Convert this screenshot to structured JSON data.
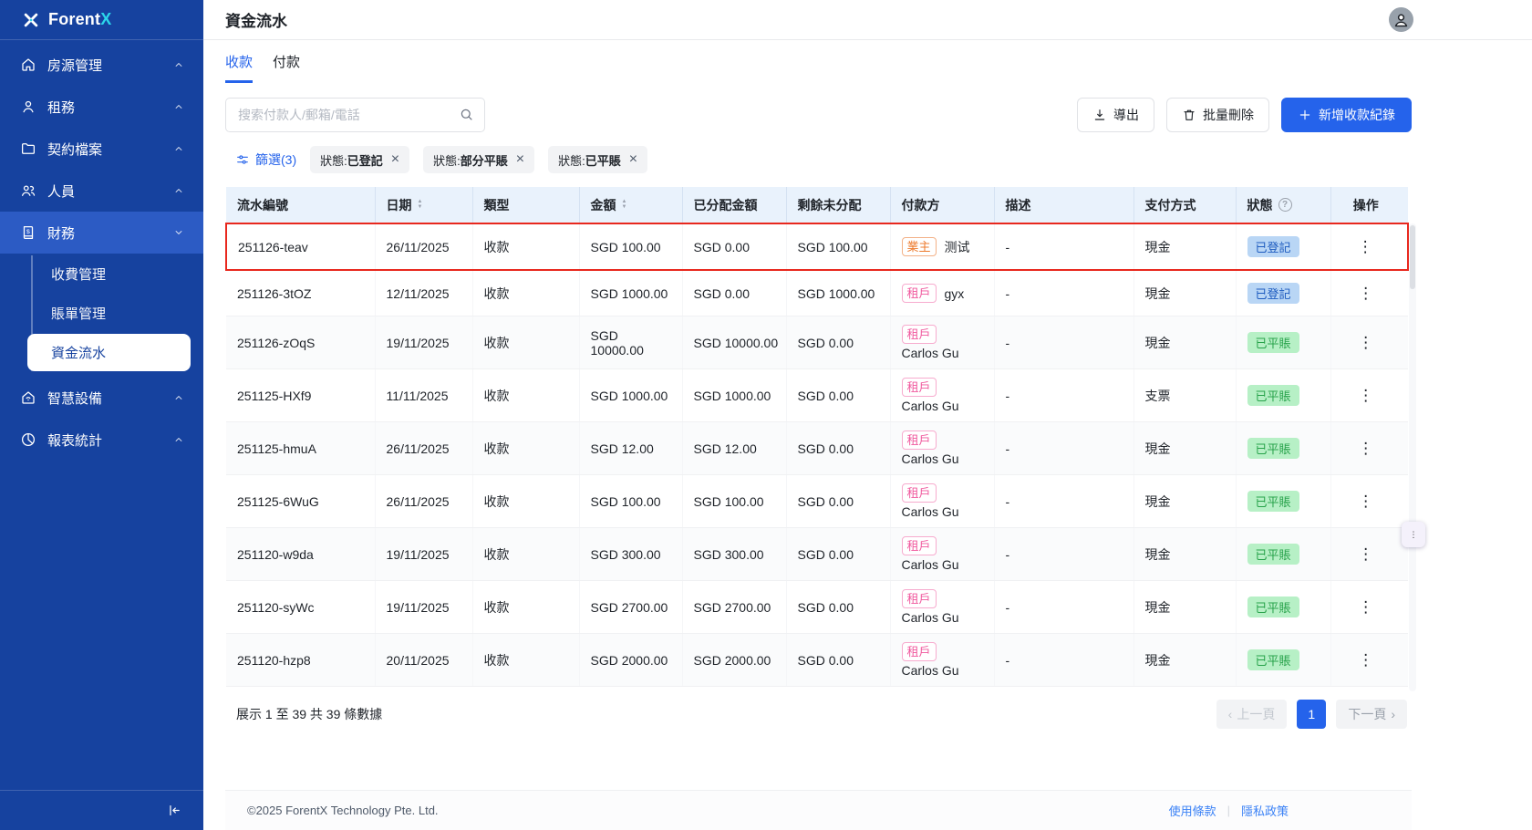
{
  "sidebar": {
    "logo": {
      "text": "Forent",
      "accent": "X"
    },
    "items": [
      {
        "name": "properties",
        "label": "房源管理",
        "icon": "home-icon",
        "expanded": false,
        "active": false
      },
      {
        "name": "leasing",
        "label": "租務",
        "icon": "user-icon",
        "expanded": false,
        "active": false
      },
      {
        "name": "contracts",
        "label": "契約檔案",
        "icon": "folder-icon",
        "expanded": false,
        "active": false
      },
      {
        "name": "people",
        "label": "人員",
        "icon": "users-icon",
        "expanded": false,
        "active": false
      },
      {
        "name": "finance",
        "label": "財務",
        "icon": "finance-icon",
        "expanded": true,
        "active": true,
        "children": [
          {
            "name": "fee-management",
            "label": "收費管理",
            "active": false
          },
          {
            "name": "bill-management",
            "label": "賬單管理",
            "active": false
          },
          {
            "name": "fund-flow",
            "label": "資金流水",
            "active": true
          }
        ]
      },
      {
        "name": "smart-devices",
        "label": "智慧設備",
        "icon": "smart-device-icon",
        "expanded": false,
        "active": false
      },
      {
        "name": "reports",
        "label": "報表統計",
        "icon": "report-icon",
        "expanded": false,
        "active": false
      }
    ]
  },
  "header": {
    "title": "資金流水"
  },
  "tabs": [
    {
      "name": "receipts",
      "label": "收款",
      "active": true
    },
    {
      "name": "payments",
      "label": "付款",
      "active": false
    }
  ],
  "search": {
    "placeholder": "搜索付款人/郵箱/電話"
  },
  "toolbar": {
    "export_label": "導出",
    "bulk_delete_label": "批量刪除",
    "add_label": "新增收款紀錄"
  },
  "filter": {
    "label": "篩選(3)",
    "chips": [
      {
        "field": "狀態",
        "value": "已登記"
      },
      {
        "field": "狀態",
        "value": "部分平賬"
      },
      {
        "field": "狀態",
        "value": "已平賬"
      }
    ]
  },
  "table": {
    "columns": [
      {
        "label": "流水編號"
      },
      {
        "label": "日期",
        "sortable": true
      },
      {
        "label": "類型"
      },
      {
        "label": "金額",
        "sortable": true
      },
      {
        "label": "已分配金額"
      },
      {
        "label": "剩餘未分配"
      },
      {
        "label": "付款方"
      },
      {
        "label": "描述"
      },
      {
        "label": "支付方式"
      },
      {
        "label": "狀態",
        "help": true
      },
      {
        "label": "操作"
      }
    ],
    "rows": [
      {
        "id": "251126-teav",
        "date": "26/11/2025",
        "type": "收款",
        "amount": "SGD 100.00",
        "allocated": "SGD 0.00",
        "remaining": "SGD 100.00",
        "payer_tag": "業主",
        "payer_tag_type": "owner",
        "payer_name": "测试",
        "payer_stacked": false,
        "description": "-",
        "method": "現金",
        "status": "已登記",
        "status_type": "registered",
        "highlighted": true,
        "shaded": false
      },
      {
        "id": "251126-3tOZ",
        "date": "12/11/2025",
        "type": "收款",
        "amount": "SGD 1000.00",
        "allocated": "SGD 0.00",
        "remaining": "SGD 1000.00",
        "payer_tag": "租戶",
        "payer_tag_type": "tenant",
        "payer_name": "gyx",
        "payer_stacked": false,
        "description": "-",
        "method": "現金",
        "status": "已登記",
        "status_type": "registered",
        "highlighted": false,
        "shaded": false
      },
      {
        "id": "251126-zOqS",
        "date": "19/11/2025",
        "type": "收款",
        "amount": "SGD 10000.00",
        "allocated": "SGD 10000.00",
        "remaining": "SGD 0.00",
        "payer_tag": "租戶",
        "payer_tag_type": "tenant",
        "payer_name": "Carlos Gu",
        "payer_stacked": true,
        "description": "-",
        "method": "現金",
        "status": "已平賬",
        "status_type": "settled",
        "highlighted": false,
        "shaded": true
      },
      {
        "id": "251125-HXf9",
        "date": "11/11/2025",
        "type": "收款",
        "amount": "SGD 1000.00",
        "allocated": "SGD 1000.00",
        "remaining": "SGD 0.00",
        "payer_tag": "租戶",
        "payer_tag_type": "tenant",
        "payer_name": "Carlos Gu",
        "payer_stacked": true,
        "description": "-",
        "method": "支票",
        "status": "已平賬",
        "status_type": "settled",
        "highlighted": false,
        "shaded": false
      },
      {
        "id": "251125-hmuA",
        "date": "26/11/2025",
        "type": "收款",
        "amount": "SGD 12.00",
        "allocated": "SGD 12.00",
        "remaining": "SGD 0.00",
        "payer_tag": "租戶",
        "payer_tag_type": "tenant",
        "payer_name": "Carlos Gu",
        "payer_stacked": true,
        "description": "-",
        "method": "現金",
        "status": "已平賬",
        "status_type": "settled",
        "highlighted": false,
        "shaded": true
      },
      {
        "id": "251125-6WuG",
        "date": "26/11/2025",
        "type": "收款",
        "amount": "SGD 100.00",
        "allocated": "SGD 100.00",
        "remaining": "SGD 0.00",
        "payer_tag": "租戶",
        "payer_tag_type": "tenant",
        "payer_name": "Carlos Gu",
        "payer_stacked": true,
        "description": "-",
        "method": "現金",
        "status": "已平賬",
        "status_type": "settled",
        "highlighted": false,
        "shaded": false
      },
      {
        "id": "251120-w9da",
        "date": "19/11/2025",
        "type": "收款",
        "amount": "SGD 300.00",
        "allocated": "SGD 300.00",
        "remaining": "SGD 0.00",
        "payer_tag": "租戶",
        "payer_tag_type": "tenant",
        "payer_name": "Carlos Gu",
        "payer_stacked": true,
        "description": "-",
        "method": "現金",
        "status": "已平賬",
        "status_type": "settled",
        "highlighted": false,
        "shaded": true
      },
      {
        "id": "251120-syWc",
        "date": "19/11/2025",
        "type": "收款",
        "amount": "SGD 2700.00",
        "allocated": "SGD 2700.00",
        "remaining": "SGD 0.00",
        "payer_tag": "租戶",
        "payer_tag_type": "tenant",
        "payer_name": "Carlos Gu",
        "payer_stacked": true,
        "description": "-",
        "method": "現金",
        "status": "已平賬",
        "status_type": "settled",
        "highlighted": false,
        "shaded": false
      },
      {
        "id": "251120-hzp8",
        "date": "20/11/2025",
        "type": "收款",
        "amount": "SGD 2000.00",
        "allocated": "SGD 2000.00",
        "remaining": "SGD 0.00",
        "payer_tag": "租戶",
        "payer_tag_type": "tenant",
        "payer_name": "Carlos Gu",
        "payer_stacked": true,
        "description": "-",
        "method": "現金",
        "status": "已平賬",
        "status_type": "settled",
        "highlighted": false,
        "shaded": true
      }
    ],
    "summary": "展示 1 至 39 共 39 條數據"
  },
  "pagination": {
    "prev": "上一頁",
    "current": "1",
    "next": "下一頁"
  },
  "footer": {
    "copyright": "©2025 ForentX Technology Pte. Ltd.",
    "links": [
      {
        "label": "使用條款"
      },
      {
        "label": "隱私政策"
      }
    ]
  },
  "colors": {
    "primary": "#2563eb",
    "sidebar": "#16429f",
    "sidebar_active": "#2c5bc4",
    "status_registered_bg": "#b9d6f5",
    "status_registered_text": "#1d5bbf",
    "status_settled_bg": "#b7f0c6",
    "status_settled_text": "#27a24a",
    "tag_owner": "#ed7b2f",
    "tag_tenant": "#f0569c",
    "highlight_border": "#e8281e",
    "table_header_bg": "#e9f2fc"
  }
}
